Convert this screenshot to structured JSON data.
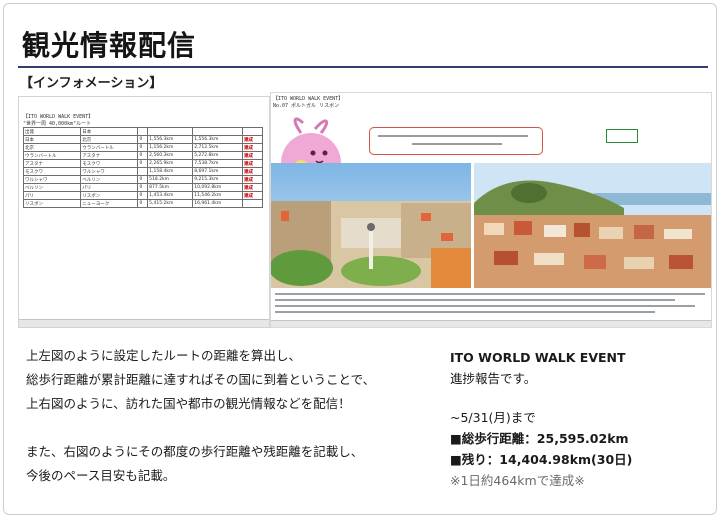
{
  "page": {
    "title": "観光情報配信",
    "subhead": "【インフォメーション】"
  },
  "sheet": {
    "header_lines": [
      "【ITO WORLD WALK EVENT】",
      "\"世界一周 40,000km\"ルート"
    ],
    "rows": [
      [
        "出発",
        "日本",
        "",
        "",
        "",
        ""
      ],
      [
        "日本",
        "北京",
        "0",
        "1,556.3km",
        "1,556.3km",
        "達成"
      ],
      [
        "北京",
        "ウランバートル",
        "0",
        "1,156.2km",
        "2,712.5km",
        "達成"
      ],
      [
        "ウランバートル",
        "アスタナ",
        "0",
        "2,560.3km",
        "5,272.8km",
        "達成"
      ],
      [
        "アスタナ",
        "モスクワ",
        "0",
        "2,265.9km",
        "7,538.7km",
        "達成"
      ],
      [
        "モスクワ",
        "ワルシャワ",
        "",
        "1,158.4km",
        "8,697.1km",
        "達成"
      ],
      [
        "ワルシャワ",
        "ベルリン",
        "0",
        "518.2km",
        "9,215.3km",
        "達成"
      ],
      [
        "ベルリン",
        "パリ",
        "0",
        "877.5km",
        "10,092.8km",
        "達成"
      ],
      [
        "パリ",
        "リスボン",
        "0",
        "1,453.4km",
        "11,546.2km",
        "達成"
      ],
      [
        "リスボン",
        "ニューヨーク",
        "0",
        "5,415.2km",
        "16,961.4km",
        ""
      ]
    ]
  },
  "shot": {
    "header_lines": [
      "【ITO WORLD WALK EVENT】",
      "No.07 ポルトガル リスボン"
    ]
  },
  "body": {
    "left_lines": [
      "上左図のように設定したルートの距離を算出し、",
      "総歩行距離が累計距離に達すればその国に到着ということで、",
      "上右図のように、訪れた国や都市の観光情報などを配信！",
      "",
      "また、右図のようにその都度の歩行距離や残距離を記載し、",
      "今後のペース目安も記載。"
    ],
    "event_name": "ITO WORLD WALK EVENT",
    "report": "進捗報告です。",
    "until": "~5/31(月)まで",
    "total": "■総歩行距離：25,595.02km",
    "remaining": "■残り：14,404.98km(30日)",
    "note": "※1日約464kmで達成※"
  },
  "colors": {
    "title_rule": "#2f3f6e",
    "callout_border": "#d8504a",
    "achieved": "#cc0000",
    "mascot": "#f0a8d4"
  },
  "icons": [
    "pink-mascot-icon"
  ]
}
